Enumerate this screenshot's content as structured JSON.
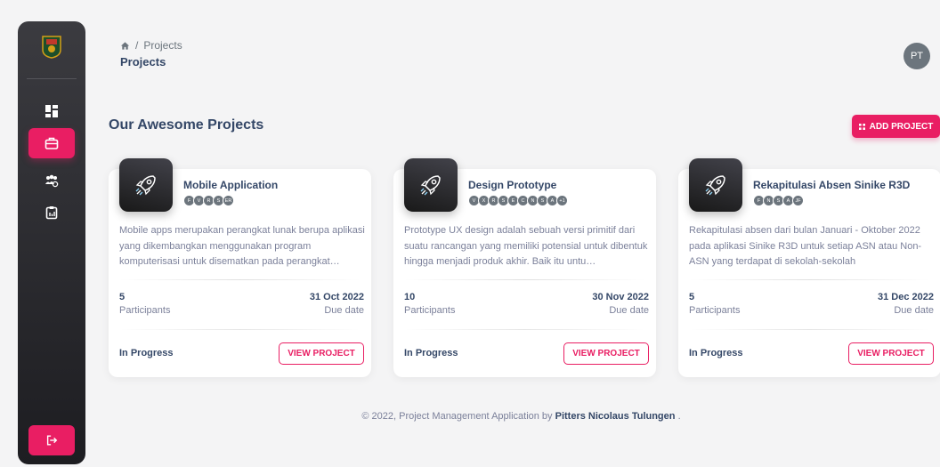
{
  "breadcrumb": {
    "parent": "Projects",
    "current": "Projects"
  },
  "user": {
    "initials": "PT"
  },
  "section": {
    "title": "Our Awesome Projects",
    "add_button": "ADD PROJECT"
  },
  "projects": [
    {
      "title": "Mobile Application",
      "members": [
        "F",
        "V",
        "R",
        "S",
        "ER"
      ],
      "description": "Mobile apps merupakan perangkat lunak berupa aplikasi yang dikembangkan menggunakan program komputerisasi untuk disematkan pada perangkat…",
      "participants": "5",
      "participants_label": "Participants",
      "due_date": "31 Oct 2022",
      "due_label": "Due date",
      "status": "In Progress",
      "button": "VIEW PROJECT"
    },
    {
      "title": "Design Prototype",
      "members": [
        "V",
        "X",
        "R",
        "S",
        "E",
        "C",
        "N",
        "S",
        "A",
        "+1"
      ],
      "description": "Prototype UX design adalah sebuah versi primitif dari suatu rancangan yang memiliki potensial untuk dibentuk hingga menjadi produk akhir. Baik itu untu…",
      "participants": "10",
      "participants_label": "Participants",
      "due_date": "30 Nov 2022",
      "due_label": "Due date",
      "status": "In Progress",
      "button": "VIEW PROJECT"
    },
    {
      "title": "Rekapitulasi Absen Sinike R3D",
      "members": [
        "F",
        "N",
        "S",
        "A",
        "JF"
      ],
      "description": "Rekapitulasi absen dari bulan Januari - Oktober 2022 pada aplikasi Sinike R3D untuk setiap ASN atau Non-ASN yang terdapat di sekolah-sekolah",
      "participants": "5",
      "participants_label": "Participants",
      "due_date": "31 Dec 2022",
      "due_label": "Due date",
      "status": "In Progress",
      "button": "VIEW PROJECT"
    }
  ],
  "footer": {
    "text": "© 2022, Project Management Application by",
    "author": "Pitters Nicolaus Tulungen",
    "suffix": "."
  },
  "colors": {
    "accent": "#e91e63",
    "sidebar": "#2a2a2e",
    "text": "#344767",
    "muted": "#7b809a"
  },
  "icons": [
    "home-icon",
    "dashboard-icon",
    "briefcase-icon",
    "users-icon",
    "report-icon",
    "logout-icon",
    "rocket-icon",
    "grid-icon"
  ]
}
